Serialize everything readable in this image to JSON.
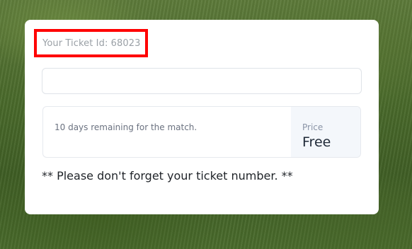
{
  "ticket": {
    "id_text": "Your Ticket Id: 68023"
  },
  "input": {
    "value": "",
    "placeholder": ""
  },
  "match": {
    "remaining_text": "10 days remaining for the match.",
    "price_label": "Price",
    "price_value": "Free"
  },
  "notice": {
    "text": "** Please don't forget your ticket number. **"
  },
  "colors": {
    "highlight_border": "#ff0000",
    "card_background": "#ffffff",
    "price_panel_background": "#f4f7fb"
  }
}
